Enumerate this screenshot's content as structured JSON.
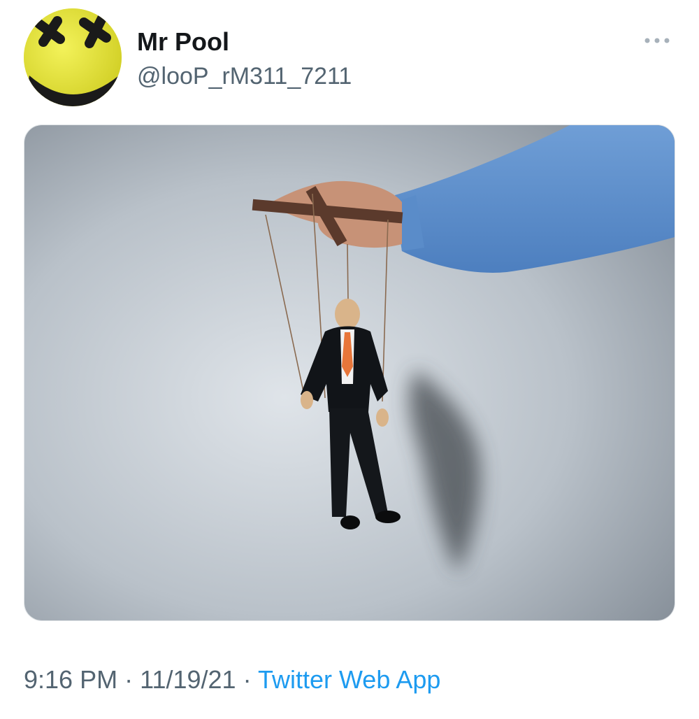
{
  "tweet": {
    "author": {
      "display_name": "Mr Pool",
      "handle": "@looP_rM311_7211",
      "avatar_icon": "smiley-face-avatar-icon"
    },
    "more_icon": "more-options-icon",
    "media": {
      "icon": "marionette-businessman-photo"
    },
    "timestamp": {
      "time": "9:16 PM",
      "separator": "·",
      "date": "11/19/21",
      "source": "Twitter Web App"
    }
  },
  "colors": {
    "name": "#14171a",
    "secondary": "#536471",
    "link": "#1d9bf0",
    "avatar_yellow": "#e8e63a"
  }
}
